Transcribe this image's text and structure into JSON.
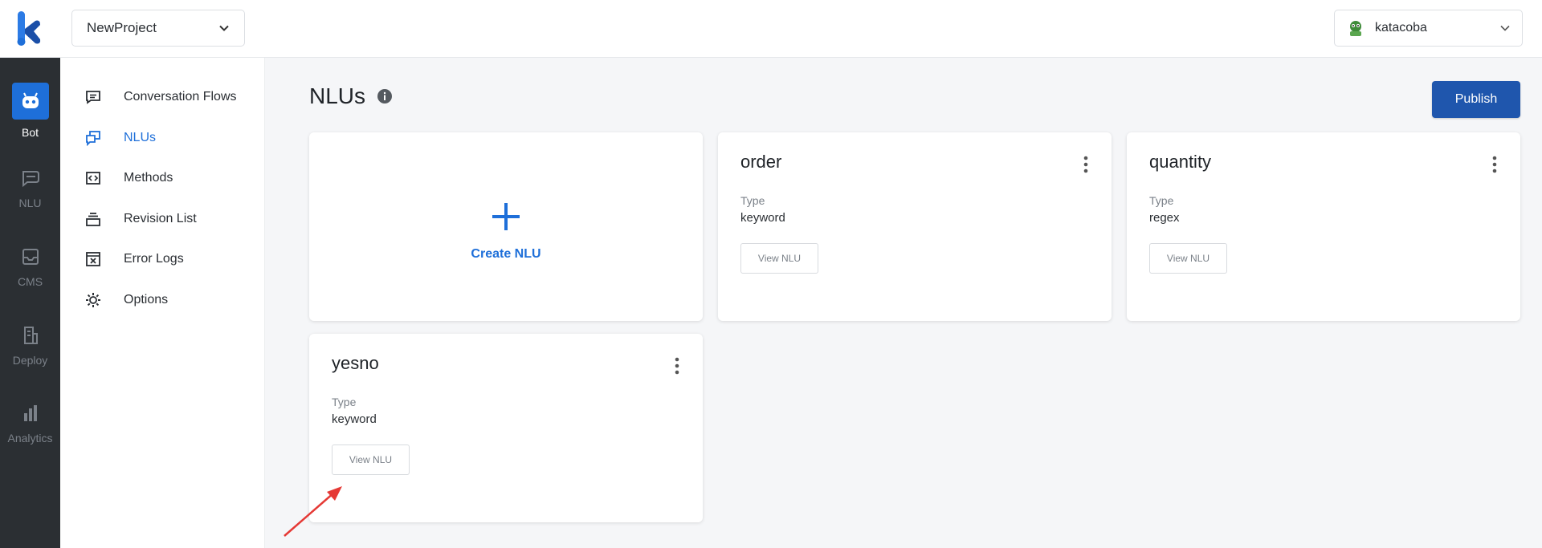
{
  "header": {
    "project": "NewProject",
    "user": "katacoba"
  },
  "rail": {
    "items": [
      {
        "label": "Bot",
        "icon": "bot-icon",
        "active": true
      },
      {
        "label": "NLU",
        "icon": "chat-bubble-icon",
        "active": false
      },
      {
        "label": "CMS",
        "icon": "inbox-icon",
        "active": false
      },
      {
        "label": "Deploy",
        "icon": "building-icon",
        "active": false
      },
      {
        "label": "Analytics",
        "icon": "bar-chart-icon",
        "active": false
      }
    ]
  },
  "sidebar": {
    "items": [
      {
        "label": "Conversation Flows",
        "icon": "message-icon"
      },
      {
        "label": "NLUs",
        "icon": "chat-stack-icon",
        "active": true
      },
      {
        "label": "Methods",
        "icon": "code-icon"
      },
      {
        "label": "Revision List",
        "icon": "layers-icon"
      },
      {
        "label": "Error Logs",
        "icon": "error-window-icon"
      },
      {
        "label": "Options",
        "icon": "gear-icon"
      }
    ]
  },
  "main": {
    "title": "NLUs",
    "publish_label": "Publish",
    "create_label": "Create NLU",
    "type_label": "Type",
    "view_label": "View NLU",
    "cards": [
      {
        "name": "order",
        "type": "keyword"
      },
      {
        "name": "quantity",
        "type": "regex"
      },
      {
        "name": "yesno",
        "type": "keyword"
      }
    ]
  },
  "colors": {
    "accent": "#1e6fd9",
    "publish": "#1f56ad",
    "rail": "#2b2f33",
    "annotation_arrow": "#e53935"
  }
}
